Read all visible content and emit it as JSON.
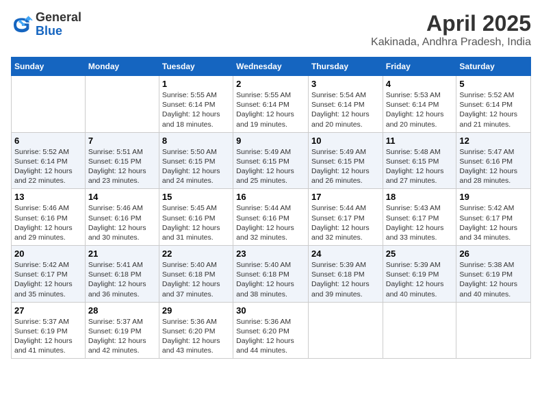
{
  "header": {
    "logo_line1": "General",
    "logo_line2": "Blue",
    "title": "April 2025",
    "subtitle": "Kakinada, Andhra Pradesh, India"
  },
  "columns": [
    "Sunday",
    "Monday",
    "Tuesday",
    "Wednesday",
    "Thursday",
    "Friday",
    "Saturday"
  ],
  "weeks": [
    [
      {
        "day": "",
        "info": ""
      },
      {
        "day": "",
        "info": ""
      },
      {
        "day": "1",
        "info": "Sunrise: 5:55 AM\nSunset: 6:14 PM\nDaylight: 12 hours and 18 minutes."
      },
      {
        "day": "2",
        "info": "Sunrise: 5:55 AM\nSunset: 6:14 PM\nDaylight: 12 hours and 19 minutes."
      },
      {
        "day": "3",
        "info": "Sunrise: 5:54 AM\nSunset: 6:14 PM\nDaylight: 12 hours and 20 minutes."
      },
      {
        "day": "4",
        "info": "Sunrise: 5:53 AM\nSunset: 6:14 PM\nDaylight: 12 hours and 20 minutes."
      },
      {
        "day": "5",
        "info": "Sunrise: 5:52 AM\nSunset: 6:14 PM\nDaylight: 12 hours and 21 minutes."
      }
    ],
    [
      {
        "day": "6",
        "info": "Sunrise: 5:52 AM\nSunset: 6:14 PM\nDaylight: 12 hours and 22 minutes."
      },
      {
        "day": "7",
        "info": "Sunrise: 5:51 AM\nSunset: 6:15 PM\nDaylight: 12 hours and 23 minutes."
      },
      {
        "day": "8",
        "info": "Sunrise: 5:50 AM\nSunset: 6:15 PM\nDaylight: 12 hours and 24 minutes."
      },
      {
        "day": "9",
        "info": "Sunrise: 5:49 AM\nSunset: 6:15 PM\nDaylight: 12 hours and 25 minutes."
      },
      {
        "day": "10",
        "info": "Sunrise: 5:49 AM\nSunset: 6:15 PM\nDaylight: 12 hours and 26 minutes."
      },
      {
        "day": "11",
        "info": "Sunrise: 5:48 AM\nSunset: 6:15 PM\nDaylight: 12 hours and 27 minutes."
      },
      {
        "day": "12",
        "info": "Sunrise: 5:47 AM\nSunset: 6:16 PM\nDaylight: 12 hours and 28 minutes."
      }
    ],
    [
      {
        "day": "13",
        "info": "Sunrise: 5:46 AM\nSunset: 6:16 PM\nDaylight: 12 hours and 29 minutes."
      },
      {
        "day": "14",
        "info": "Sunrise: 5:46 AM\nSunset: 6:16 PM\nDaylight: 12 hours and 30 minutes."
      },
      {
        "day": "15",
        "info": "Sunrise: 5:45 AM\nSunset: 6:16 PM\nDaylight: 12 hours and 31 minutes."
      },
      {
        "day": "16",
        "info": "Sunrise: 5:44 AM\nSunset: 6:16 PM\nDaylight: 12 hours and 32 minutes."
      },
      {
        "day": "17",
        "info": "Sunrise: 5:44 AM\nSunset: 6:17 PM\nDaylight: 12 hours and 32 minutes."
      },
      {
        "day": "18",
        "info": "Sunrise: 5:43 AM\nSunset: 6:17 PM\nDaylight: 12 hours and 33 minutes."
      },
      {
        "day": "19",
        "info": "Sunrise: 5:42 AM\nSunset: 6:17 PM\nDaylight: 12 hours and 34 minutes."
      }
    ],
    [
      {
        "day": "20",
        "info": "Sunrise: 5:42 AM\nSunset: 6:17 PM\nDaylight: 12 hours and 35 minutes."
      },
      {
        "day": "21",
        "info": "Sunrise: 5:41 AM\nSunset: 6:18 PM\nDaylight: 12 hours and 36 minutes."
      },
      {
        "day": "22",
        "info": "Sunrise: 5:40 AM\nSunset: 6:18 PM\nDaylight: 12 hours and 37 minutes."
      },
      {
        "day": "23",
        "info": "Sunrise: 5:40 AM\nSunset: 6:18 PM\nDaylight: 12 hours and 38 minutes."
      },
      {
        "day": "24",
        "info": "Sunrise: 5:39 AM\nSunset: 6:18 PM\nDaylight: 12 hours and 39 minutes."
      },
      {
        "day": "25",
        "info": "Sunrise: 5:39 AM\nSunset: 6:19 PM\nDaylight: 12 hours and 40 minutes."
      },
      {
        "day": "26",
        "info": "Sunrise: 5:38 AM\nSunset: 6:19 PM\nDaylight: 12 hours and 40 minutes."
      }
    ],
    [
      {
        "day": "27",
        "info": "Sunrise: 5:37 AM\nSunset: 6:19 PM\nDaylight: 12 hours and 41 minutes."
      },
      {
        "day": "28",
        "info": "Sunrise: 5:37 AM\nSunset: 6:19 PM\nDaylight: 12 hours and 42 minutes."
      },
      {
        "day": "29",
        "info": "Sunrise: 5:36 AM\nSunset: 6:20 PM\nDaylight: 12 hours and 43 minutes."
      },
      {
        "day": "30",
        "info": "Sunrise: 5:36 AM\nSunset: 6:20 PM\nDaylight: 12 hours and 44 minutes."
      },
      {
        "day": "",
        "info": ""
      },
      {
        "day": "",
        "info": ""
      },
      {
        "day": "",
        "info": ""
      }
    ]
  ]
}
